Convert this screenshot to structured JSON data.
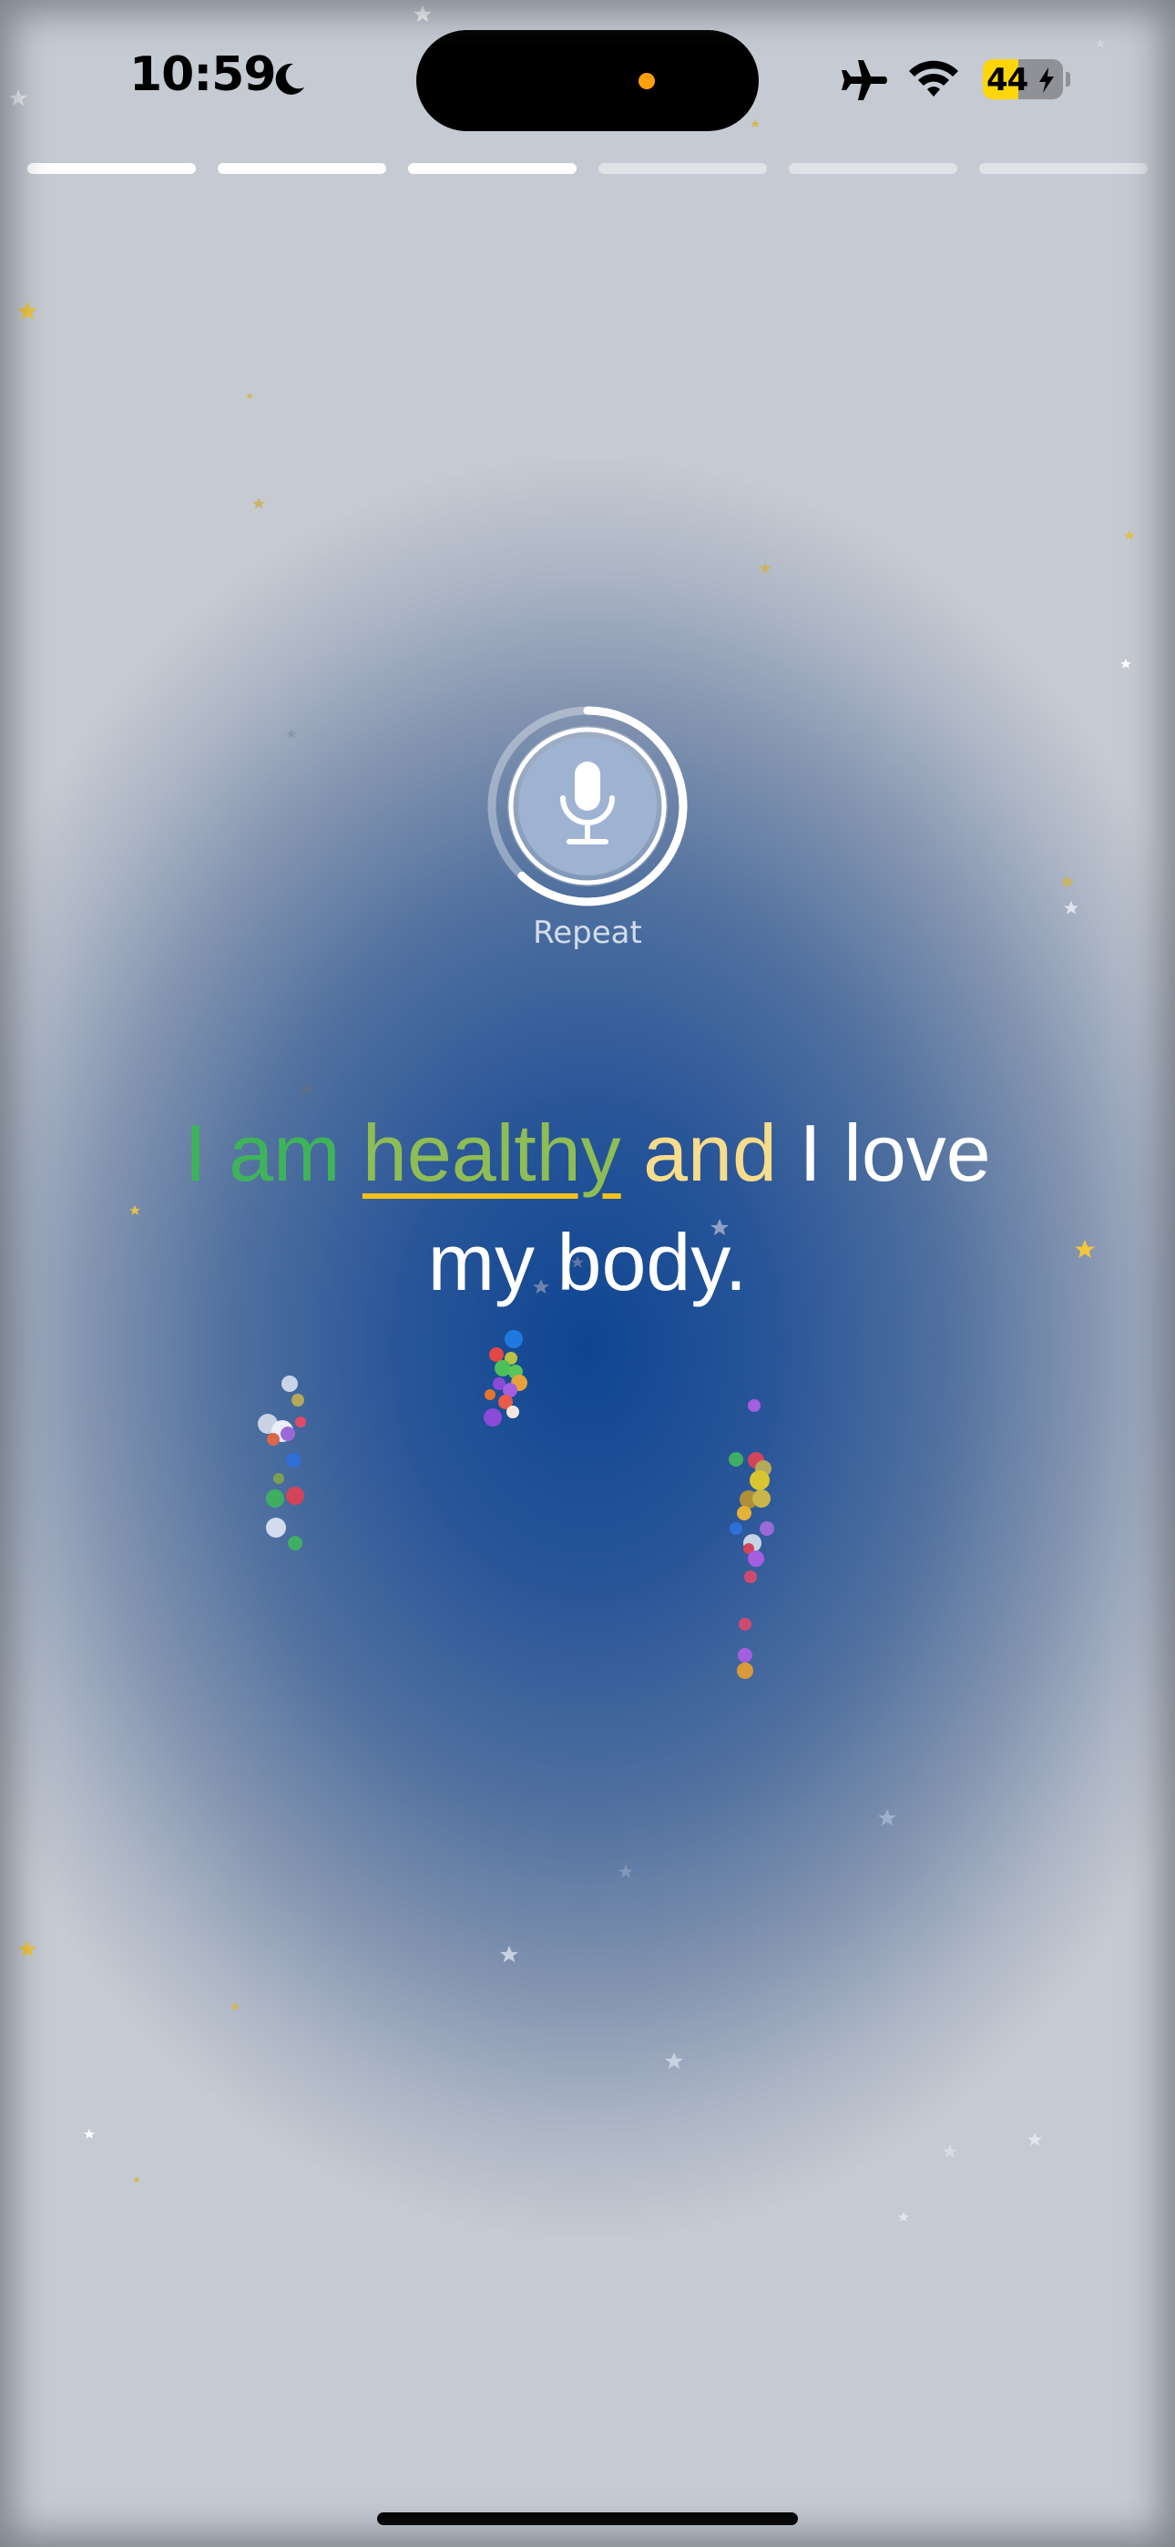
{
  "status_bar": {
    "time": "10:59",
    "battery_level": "44",
    "focus_icon": "moon-icon",
    "icons": [
      "airplane-icon",
      "wifi-icon",
      "battery-charging-icon"
    ]
  },
  "progress": {
    "total_segments": 6,
    "completed_segments": 3
  },
  "mic": {
    "label": "Repeat",
    "icon": "microphone-icon",
    "ring_progress": 0.62
  },
  "phrase": {
    "line1": [
      {
        "text": "I am",
        "color": "#3fb35a"
      },
      {
        "text": " ",
        "color": "#ffffff"
      },
      {
        "text": "healthy",
        "color": "#8fbd55",
        "current": true
      },
      {
        "text": " ",
        "color": "#ffffff"
      },
      {
        "text": "and",
        "color": "#f7dc8c"
      },
      {
        "text": " I love",
        "color": "#ffffff"
      }
    ],
    "line2": [
      {
        "text": "my body.",
        "color": "#ffffff"
      }
    ]
  },
  "colors": {
    "background_center": "#0e4592",
    "background_edge": "#c6cad2",
    "underline": "#f2c21b",
    "star_gold": "#f1c83a",
    "star_white": "#e9edf5"
  }
}
